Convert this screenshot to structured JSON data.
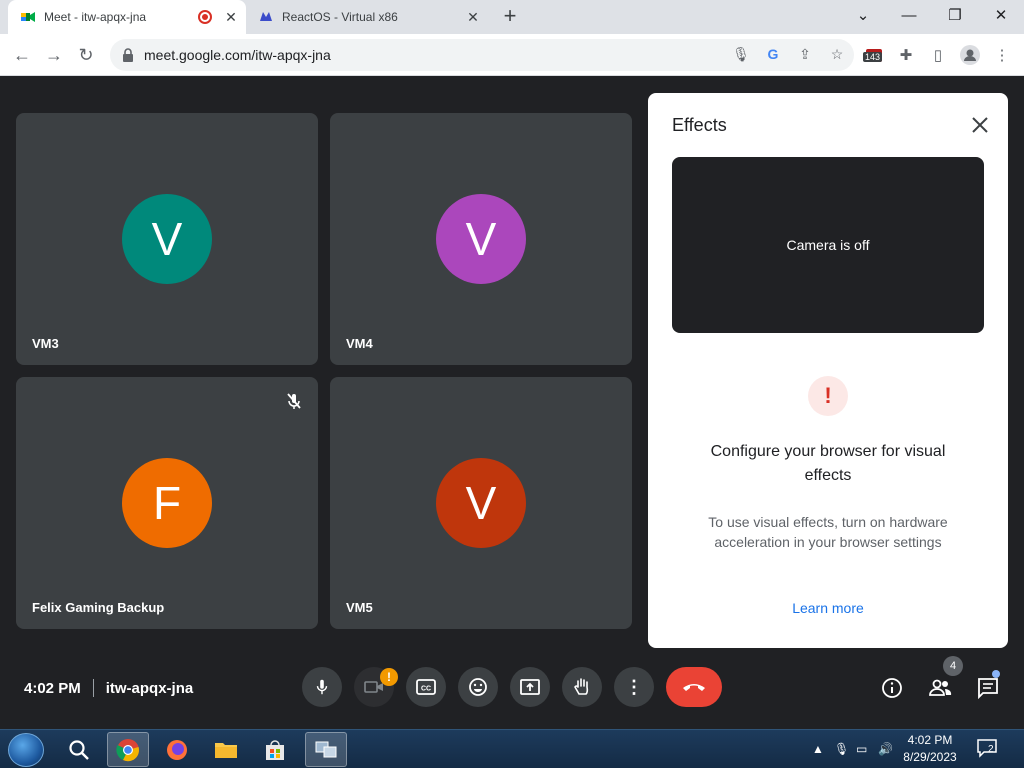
{
  "browser": {
    "tabs": [
      {
        "title": "Meet - itw-apqx-jna",
        "active": true,
        "recording": true
      },
      {
        "title": "ReactOS - Virtual x86",
        "active": false
      }
    ],
    "url": "meet.google.com/itw-apqx-jna",
    "extension_badge": "143"
  },
  "tiles": [
    {
      "name": "VM3",
      "initial": "V",
      "color": "#00897b",
      "muted": false
    },
    {
      "name": "VM4",
      "initial": "V",
      "color": "#ab47bc",
      "muted": false
    },
    {
      "name": "Felix Gaming Backup",
      "initial": "F",
      "color": "#ef6c00",
      "muted": true
    },
    {
      "name": "VM5",
      "initial": "V",
      "color": "#bf360c",
      "muted": false
    }
  ],
  "effects": {
    "title": "Effects",
    "preview_text": "Camera is off",
    "config_title": "Configure your browser for visual effects",
    "config_body": "To use visual effects, turn on hardware acceleration in your browser settings",
    "learn_more": "Learn more"
  },
  "meeting": {
    "time": "4:02 PM",
    "code": "itw-apqx-jna",
    "participant_count": "4",
    "camera_warning": "!"
  },
  "taskbar": {
    "time": "4:02 PM",
    "date": "8/29/2023",
    "notification_count": "2"
  },
  "colors": {
    "meet_bg": "#202124",
    "tile_bg": "#3c4043",
    "hangup": "#ea4335",
    "link": "#1a73e8"
  }
}
